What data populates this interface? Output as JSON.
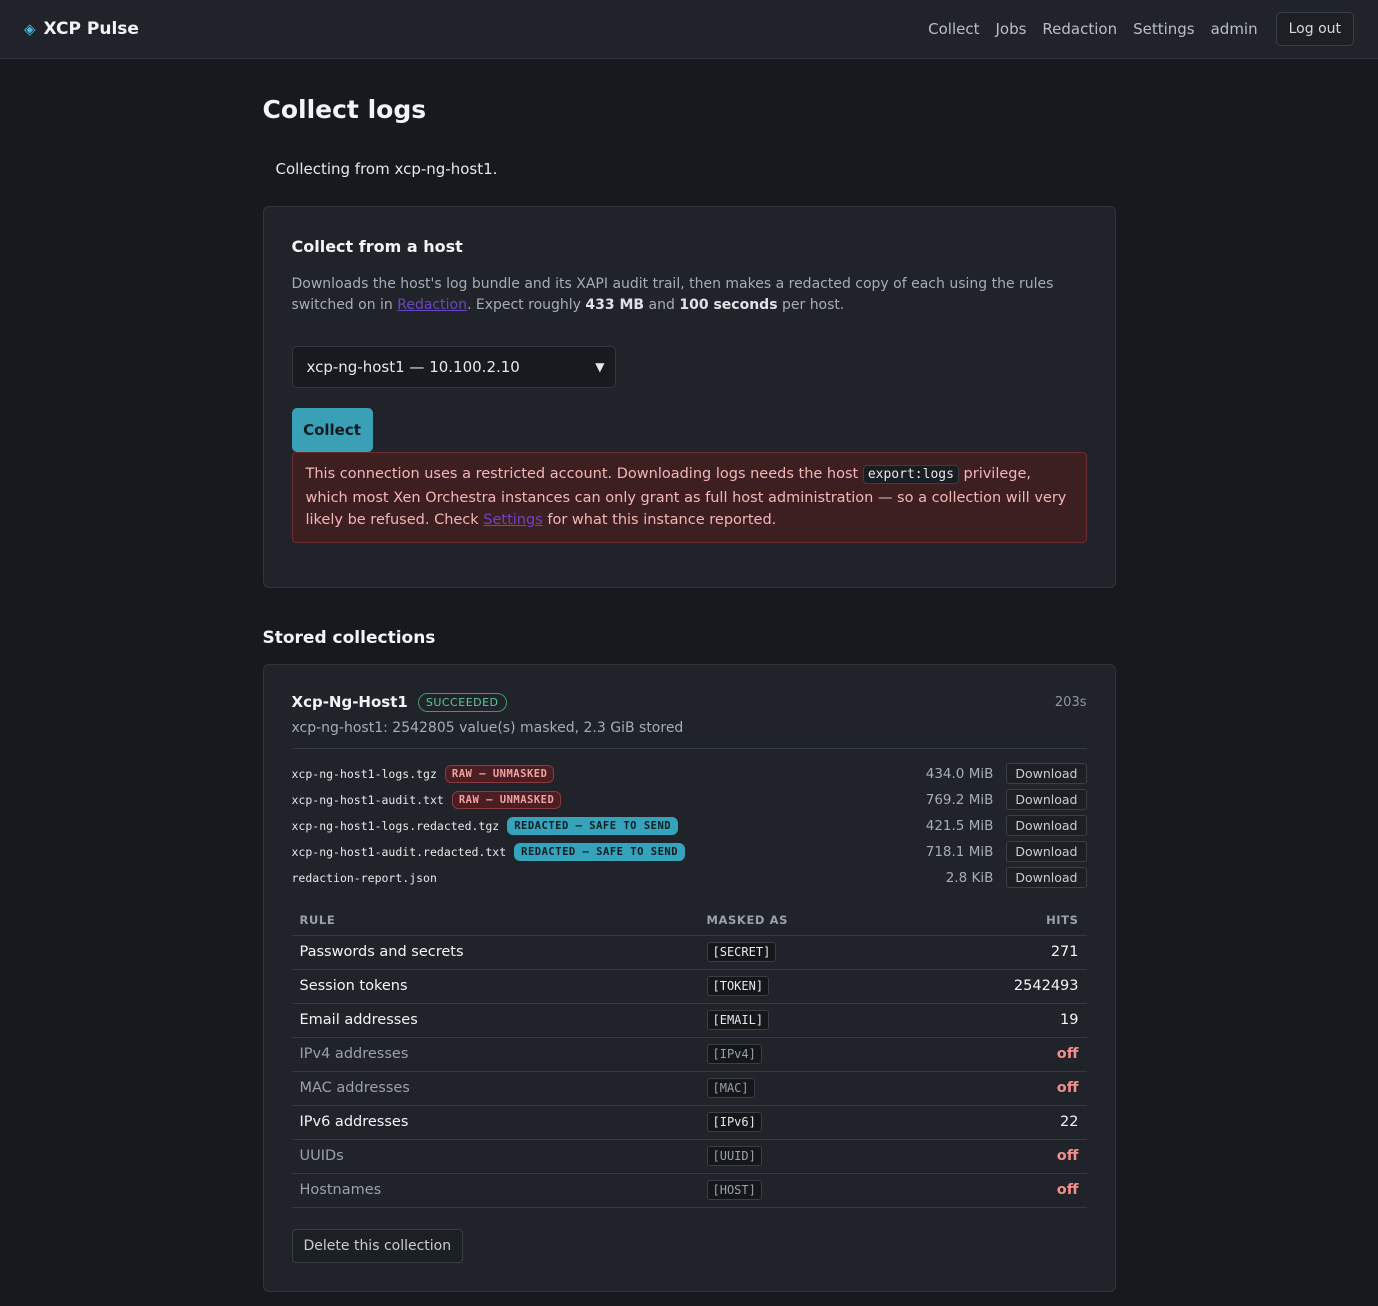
{
  "app": {
    "name": "XCP Pulse",
    "icon": "diamond-logo-icon"
  },
  "nav": {
    "collect": "Collect",
    "jobs": "Jobs",
    "redaction": "Redaction",
    "settings": "Settings",
    "user": "admin",
    "logout": "Log out"
  },
  "page": {
    "title": "Collect logs",
    "notice": "Collecting from xcp-ng-host1."
  },
  "collect_card": {
    "title": "Collect from a host",
    "desc_pre": "Downloads the host's log bundle and its XAPI audit trail, then makes a redacted copy of each using the rules switched on in ",
    "desc_link": "Redaction",
    "desc_mid1": ". Expect roughly ",
    "desc_size": "433 MB",
    "desc_mid2": " and ",
    "desc_time": "100 seconds",
    "desc_post": " per host.",
    "host_select": "xcp-ng-host1 — 10.100.2.10",
    "collect_button": "Collect",
    "alert": {
      "pre": "This connection uses a restricted account. Downloading logs needs the host ",
      "code": "export:logs",
      "mid": " privilege, which most Xen Orchestra instances can only grant as full host administration — so a collection will very likely be refused. Check ",
      "link": "Settings",
      "post": " for what this instance reported."
    }
  },
  "stored": {
    "heading": "Stored collections",
    "collection": {
      "title": "Xcp-Ng-Host1",
      "status": "SUCCEEDED",
      "duration": "203s",
      "summary": "xcp-ng-host1: 2542805 value(s) masked, 2.3 GiB stored",
      "files": [
        {
          "name": "xcp-ng-host1-logs.tgz",
          "tag": "RAW — UNMASKED",
          "size": "434.0 MiB",
          "download": "Download"
        },
        {
          "name": "xcp-ng-host1-audit.txt",
          "tag": "RAW — UNMASKED",
          "size": "769.2 MiB",
          "download": "Download"
        },
        {
          "name": "xcp-ng-host1-logs.redacted.tgz",
          "tag": "REDACTED — SAFE TO SEND",
          "size": "421.5 MiB",
          "download": "Download"
        },
        {
          "name": "xcp-ng-host1-audit.redacted.txt",
          "tag": "REDACTED — SAFE TO SEND",
          "size": "718.1 MiB",
          "download": "Download"
        },
        {
          "name": "redaction-report.json",
          "tag": "",
          "size": "2.8 KiB",
          "download": "Download"
        }
      ],
      "rules_headers": {
        "rule": "RULE",
        "masked": "MASKED AS",
        "hits": "HITS"
      },
      "rules": [
        {
          "rule": "Passwords and secrets",
          "masked": "[SECRET]",
          "hits": "271"
        },
        {
          "rule": "Session tokens",
          "masked": "[TOKEN]",
          "hits": "2542493"
        },
        {
          "rule": "Email addresses",
          "masked": "[EMAIL]",
          "hits": "19"
        },
        {
          "rule": "IPv4 addresses",
          "masked": "[IPv4]",
          "hits": "off"
        },
        {
          "rule": "MAC addresses",
          "masked": "[MAC]",
          "hits": "off"
        },
        {
          "rule": "IPv6 addresses",
          "masked": "[IPv6]",
          "hits": "22"
        },
        {
          "rule": "UUIDs",
          "masked": "[UUID]",
          "hits": "off"
        },
        {
          "rule": "Hostnames",
          "masked": "[HOST]",
          "hits": "off"
        }
      ],
      "delete_button": "Delete this collection"
    }
  }
}
